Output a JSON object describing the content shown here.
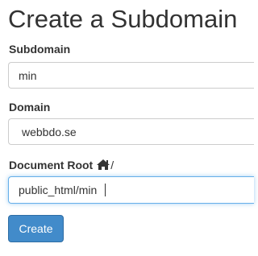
{
  "page": {
    "title": "Create a Subdomain"
  },
  "form": {
    "subdomain": {
      "label": "Subdomain",
      "value": "min"
    },
    "domain": {
      "label": "Domain",
      "value": "webbdo.se"
    },
    "document_root": {
      "label": "Document Root",
      "prefix_icon": "home-icon",
      "prefix_suffix": "/",
      "value": "public_html/min"
    },
    "submit_label": "Create"
  },
  "colors": {
    "button_bg": "#428bca",
    "focus_border": "#66afe9",
    "text": "#333333"
  }
}
